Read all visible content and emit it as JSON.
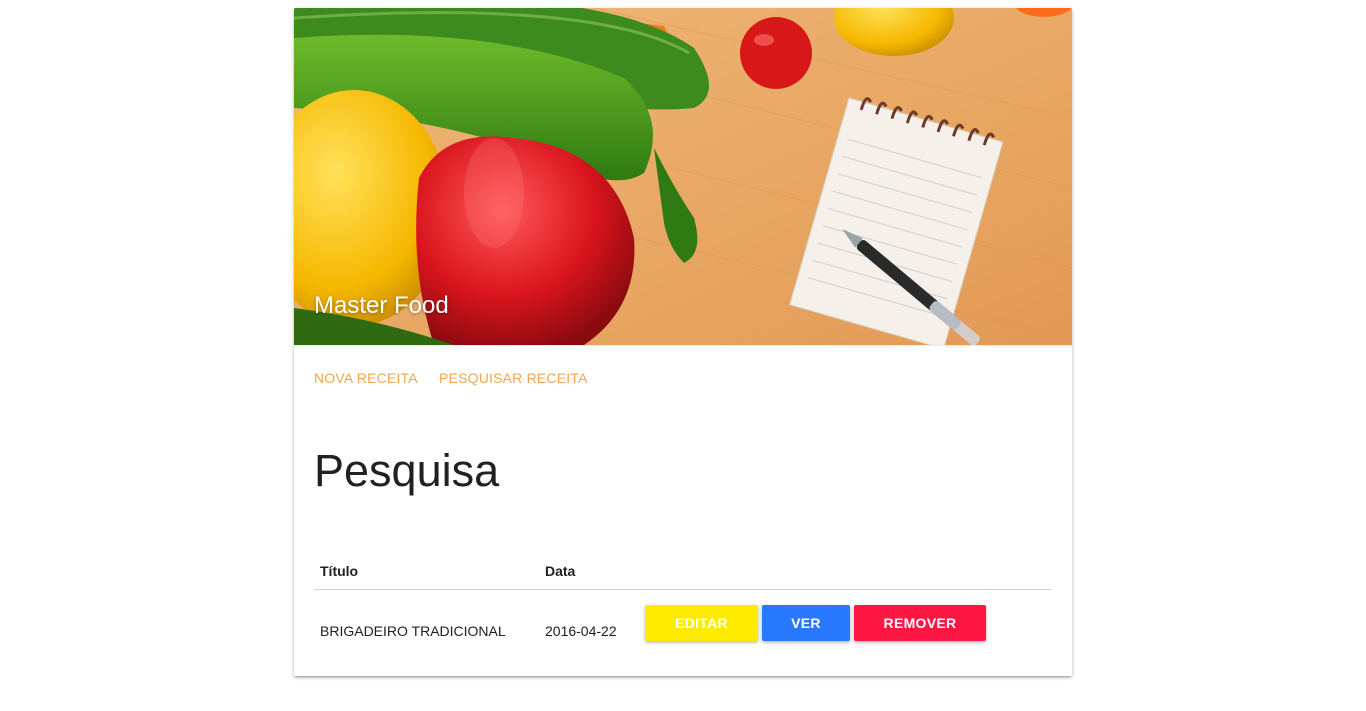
{
  "hero": {
    "title": "Master Food"
  },
  "actions": {
    "new_recipe": "NOVA RECEITA",
    "search_recipe": "PESQUISAR RECEITA"
  },
  "page": {
    "title": "Pesquisa"
  },
  "table": {
    "headers": [
      "Título",
      "Data"
    ],
    "rows": [
      {
        "title": "BRIGADEIRO TRADICIONAL",
        "date": "2016-04-22",
        "buttons": {
          "edit": "EDITAR",
          "view": "VER",
          "remove": "REMOVER"
        }
      }
    ]
  },
  "colors": {
    "accent": "#f2a454",
    "edit": "#ffeb00",
    "view": "#2979ff",
    "remove": "#ff1744"
  }
}
